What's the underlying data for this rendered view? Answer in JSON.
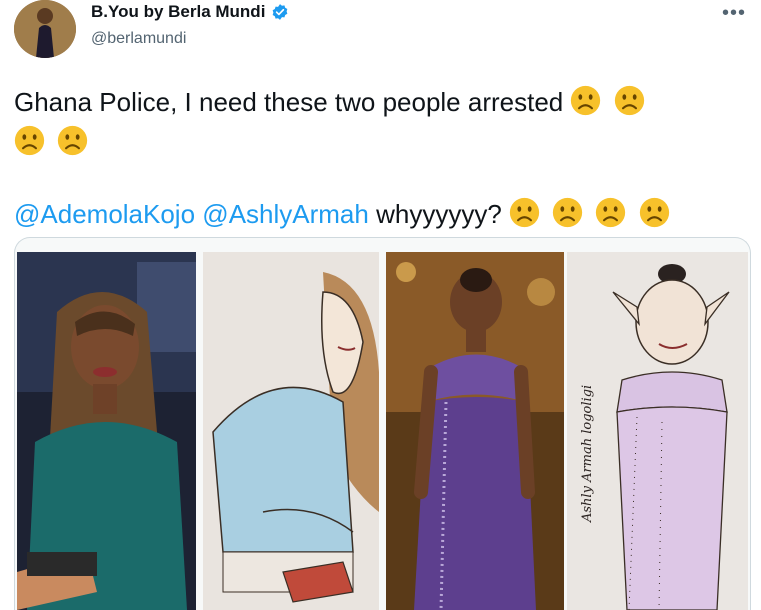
{
  "author": {
    "display_name": "B.You by Berla Mundi",
    "handle": "@berlamundi",
    "verified_icon": "verified-badge-icon",
    "avatar_icon": "profile-avatar"
  },
  "menu": {
    "more_label": "•••"
  },
  "tweet": {
    "text_line1": "Ghana Police, I need these two people arrested",
    "mention1": "@AdemolaKojo",
    "mention2": "@AshlyArmah",
    "text_line2_tail": " whyyyyyy?",
    "emoji_name": "frowning-face-icon"
  },
  "media": {
    "panels": [
      "photo-presenter",
      "drawing-presenter",
      "photo-purple-gown",
      "drawing-purple-gown"
    ],
    "drawing_signature": "Ashly Armah logoligi"
  },
  "colors": {
    "link": "#1d9bf0",
    "text": "#0f1419",
    "muted": "#536471",
    "emoji": "#f7c12b"
  }
}
